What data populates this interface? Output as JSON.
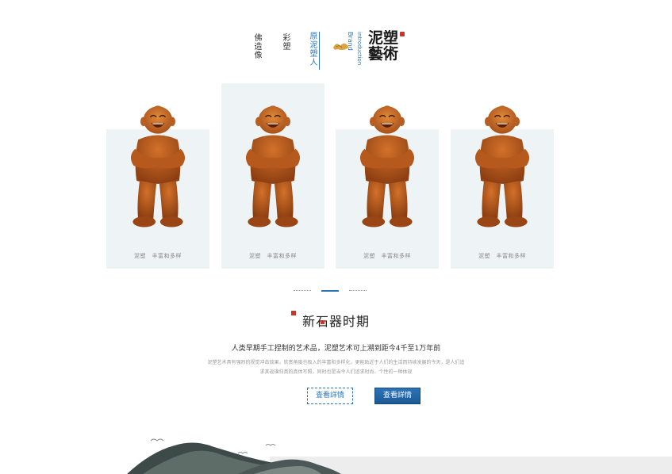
{
  "header": {
    "nav": [
      {
        "label": "佛造像"
      },
      {
        "label": "彩塑"
      },
      {
        "label": "泥塑人"
      }
    ],
    "nav_prefix": "原",
    "nav_english_title": "Brand",
    "nav_english_sub": "introduction",
    "logo_text": "泥塑藝術"
  },
  "cards": [
    {
      "label": "泥塑　丰富和多样",
      "tall": false
    },
    {
      "label": "泥塑　丰富和多样",
      "tall": true
    },
    {
      "label": "泥塑　丰富和多样",
      "tall": false
    },
    {
      "label": "泥塑　丰富和多样",
      "tall": false
    }
  ],
  "pager": {
    "count": 3,
    "active_index": 1
  },
  "intro": {
    "title": "新石器时期",
    "subtitle": "人类早期手工捏制的艺术品，泥塑艺术可上溯到距今4千至1万年前",
    "body_line1": "泥塑艺术具有强烈的视觉冲击效果，欣赏角度也极入的丰富和多样化，更能贴近于人们的生活而持续发展的今天，是人们追",
    "body_line2": "求其返璞归真的真体写照，同时也是当今人们追求时尚、个性的一种体现"
  },
  "buttons": {
    "outline_label": "查看詳情",
    "solid_label": "查看詳情"
  },
  "colors": {
    "accent": "#2f76b8",
    "card_bg": "#eef3f5",
    "seal": "#c0392b",
    "statue": "#c8661f"
  }
}
